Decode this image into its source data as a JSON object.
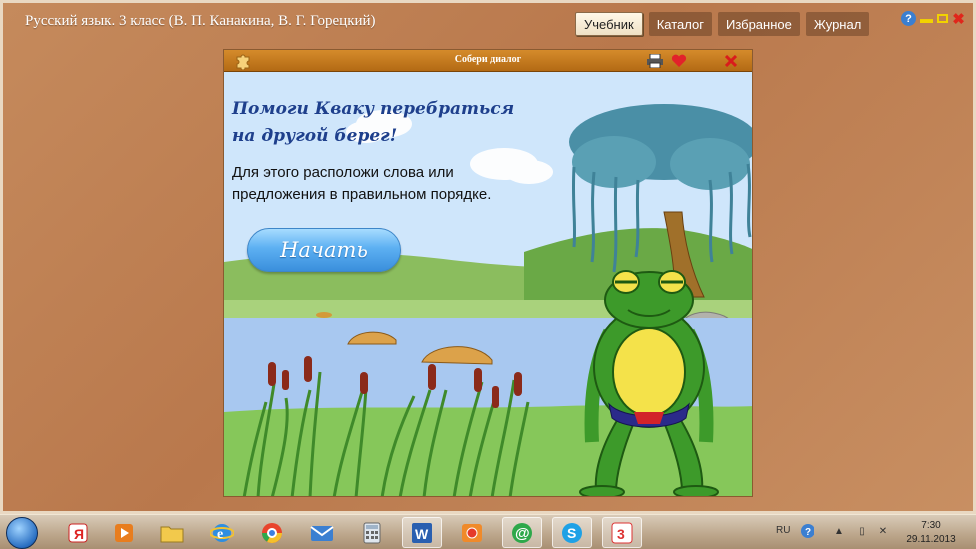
{
  "app": {
    "title": "Русский язык. 3 класс (В. П. Канакина, В. Г. Горецкий)",
    "tabs": [
      {
        "label": "Учебник",
        "active": true
      },
      {
        "label": "Каталог",
        "active": false
      },
      {
        "label": "Избранное",
        "active": false
      },
      {
        "label": "Журнал",
        "active": false
      }
    ],
    "controls": {
      "help_icon": "question-icon",
      "minimize_icon": "minimize-icon",
      "maximize_icon": "maximize-icon",
      "close_icon": "close-icon"
    }
  },
  "module": {
    "title": "Собери диалог",
    "icons": [
      "puzzle-icon",
      "printer-icon",
      "heart-icon",
      "close-icon"
    ],
    "heading": "Помоги Кваку перебраться на другой берег!",
    "instruction": "Для этого расположи слова или предложения в правильном порядке.",
    "start_button": "Начать"
  },
  "taskbar": {
    "apps": [
      "yandex-icon",
      "media-player-icon",
      "folder-icon",
      "internet-explorer-icon",
      "chrome-icon",
      "mail-icon",
      "calculator-icon",
      "word-icon",
      "app-icon",
      "mail-agent-icon",
      "skype-icon",
      "textbook-app-icon"
    ],
    "language": "RU",
    "time": "7:30",
    "date": "29.11.2013"
  },
  "colors": {
    "frame": "#b9784c",
    "module_bar": "#c57a1f",
    "heading": "#1e3f8c",
    "button": "#5db0f2",
    "sky": "#cfe6fb",
    "water": "#a8c8f0",
    "grass": "#86c75a"
  }
}
